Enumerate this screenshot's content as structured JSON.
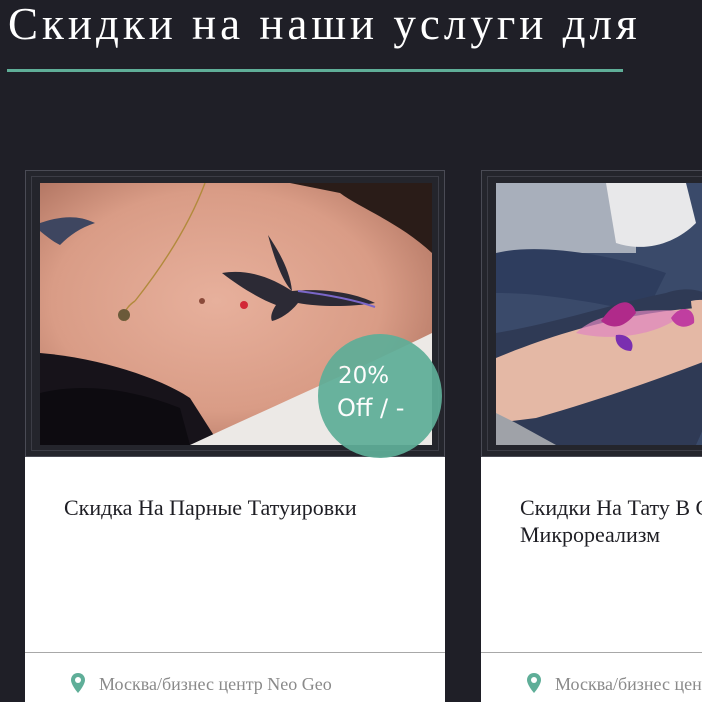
{
  "section": {
    "title": "Скидки на наши услуги для"
  },
  "colors": {
    "background": "#1f1f27",
    "accent": "#5fae98",
    "card_background": "#ffffff"
  },
  "cards": [
    {
      "image_icon": "tattoo-photo-swallow",
      "discount_percent": "20%",
      "discount_off": "Off / -",
      "title": "Скидка На Парные Татуировки",
      "location_icon": "map-pin-icon",
      "location": "Москва/бизнес центр Neo Geo"
    },
    {
      "image_icon": "tattoo-photo-butterflies",
      "title": "Скидки На Тату В Стиле Микрореализм",
      "location_icon": "map-pin-icon",
      "location": "Москва/бизнес центр Neo Geo"
    }
  ]
}
